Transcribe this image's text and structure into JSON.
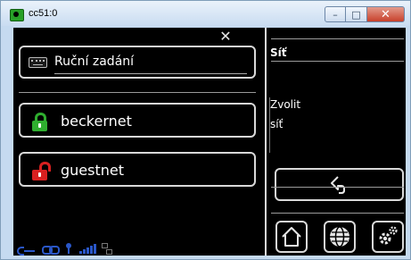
{
  "window": {
    "title": "cc51:0",
    "minimize": "–",
    "maximize": "□",
    "close": "✕"
  },
  "left": {
    "manual_label": "Ruční zadání",
    "networks": [
      {
        "name": "beckernet",
        "lock": "green"
      },
      {
        "name": "guestnet",
        "lock": "red"
      }
    ]
  },
  "right": {
    "title": "Síť",
    "desc_line1": "Zvolit",
    "desc_line2": "síť"
  },
  "colors": {
    "accent": "#2a57c8",
    "lock_green": "#2fae2f",
    "lock_red": "#d82020"
  },
  "icons": {
    "close_x": "close-overlay-icon",
    "back": "back-arrow-icon",
    "home": "home-icon",
    "globe": "globe-icon",
    "settings": "gear-icon"
  }
}
